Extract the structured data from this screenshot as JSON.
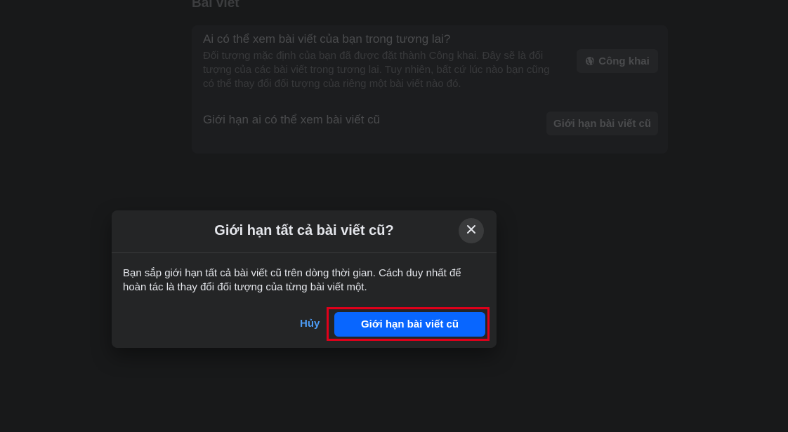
{
  "background": {
    "section_title": "Bài viết",
    "future_posts": {
      "title": "Ai có thể xem bài viết của bạn trong tương lai?",
      "description": "Đối tượng mặc định của bạn đã được đặt thành Công khai. Đây sẽ là đối tượng của các bài viết trong tương lai. Tuy nhiên, bất cứ lúc nào bạn cũng có thể thay đổi đối tượng của riêng một bài viết nào đó.",
      "audience_button": "Công khai",
      "audience_icon": "globe-icon"
    },
    "limit_past": {
      "title": "Giới hạn ai có thể xem bài viết cũ",
      "button": "Giới hạn bài viết cũ"
    }
  },
  "modal": {
    "title": "Giới hạn tất cả bài viết cũ?",
    "close_icon": "close-icon",
    "body": "Bạn sắp giới hạn tất cả bài viết cũ trên dòng thời gian. Cách duy nhất để hoàn tác là thay đổi đối tượng của từng bài viết một.",
    "cancel_label": "Hủy",
    "confirm_label": "Giới hạn bài viết cũ"
  },
  "colors": {
    "page_background": "#18191a",
    "modal_background": "#242526",
    "primary_button": "#0866ff",
    "link": "#4d9cf5",
    "highlight": "#e0001a"
  }
}
